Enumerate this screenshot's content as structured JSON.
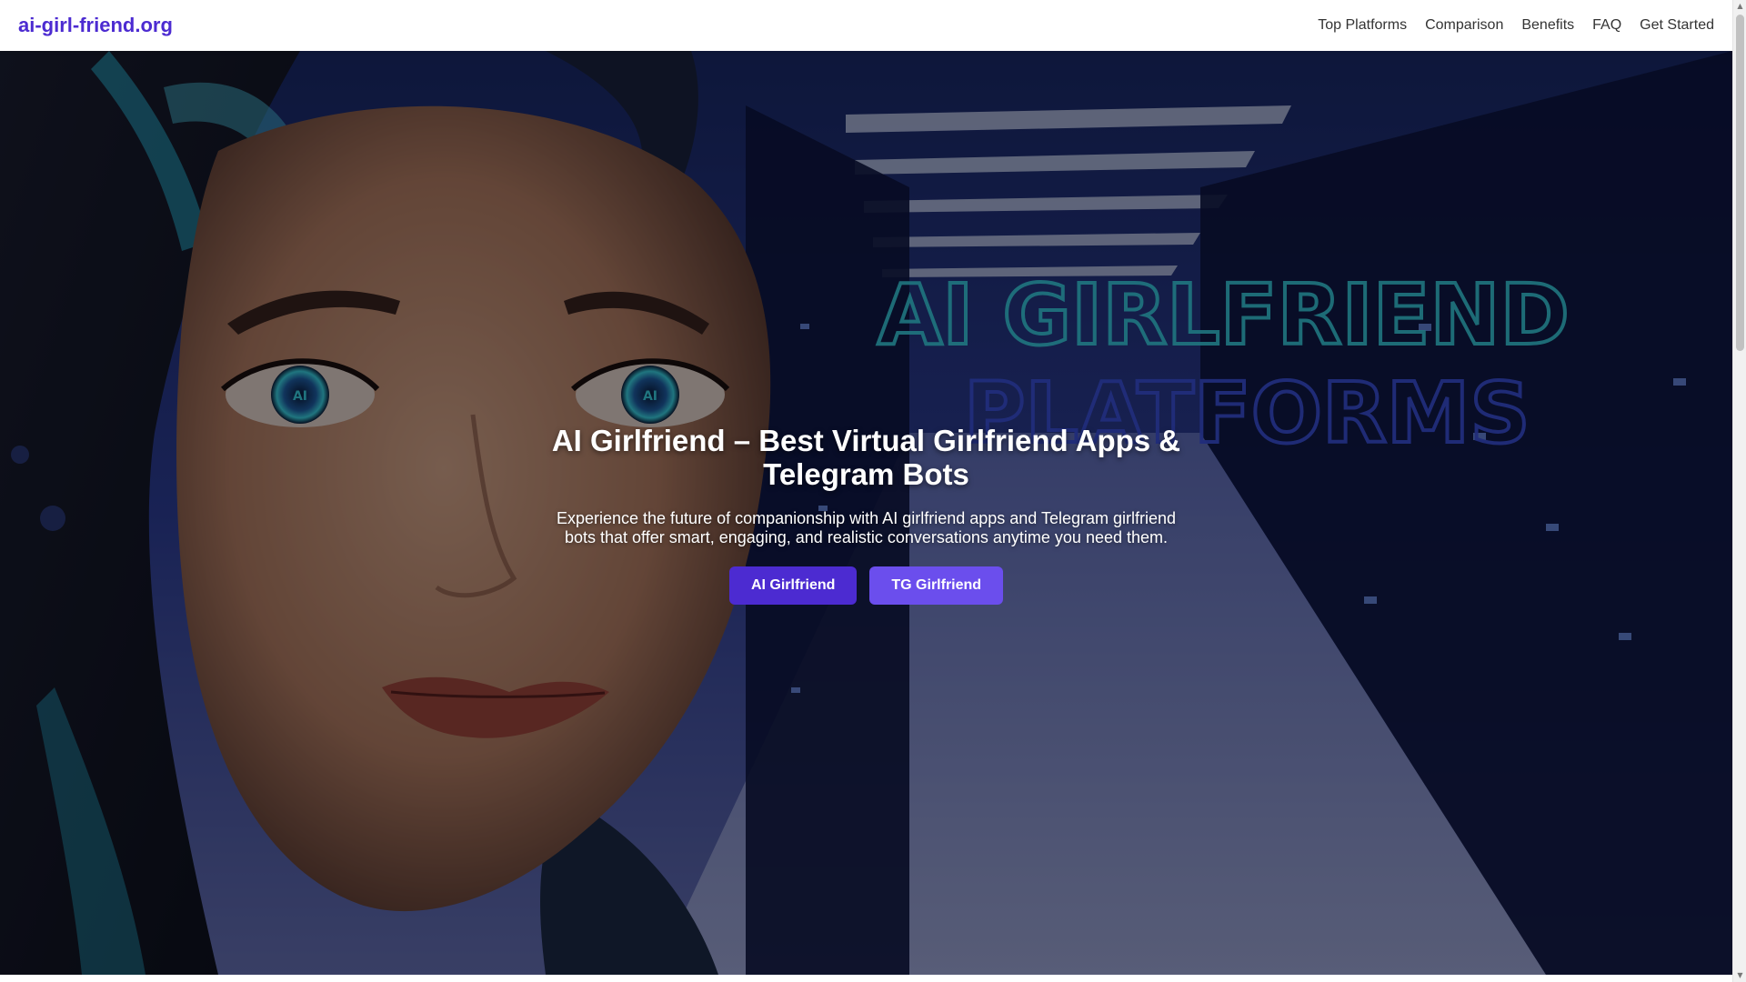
{
  "header": {
    "logo": "ai-girl-friend.org",
    "nav": [
      {
        "label": "Top Platforms"
      },
      {
        "label": "Comparison"
      },
      {
        "label": "Benefits"
      },
      {
        "label": "FAQ"
      },
      {
        "label": "Get Started"
      }
    ]
  },
  "hero": {
    "title": "AI Girlfriend – Best Virtual Girlfriend Apps & Telegram Bots",
    "subtitle": "Experience the future of companionship with AI girlfriend apps and Telegram girlfriend bots that offer smart, engaging, and realistic conversations anytime you need them.",
    "buttons": [
      {
        "label": "AI Girlfriend"
      },
      {
        "label": "TG Girlfriend"
      }
    ],
    "background_image": {
      "text_line1": "AI GIRLFRIEND",
      "text_line2": "PLATFORMS",
      "eye_label": "AI"
    }
  },
  "colors": {
    "brand": "#4c2bd1",
    "button_secondary": "#6b4eed",
    "neon_text": "#3bd6e8"
  },
  "icons": {
    "scroll_up": "chevron-up-icon",
    "scroll_down": "chevron-down-icon"
  }
}
